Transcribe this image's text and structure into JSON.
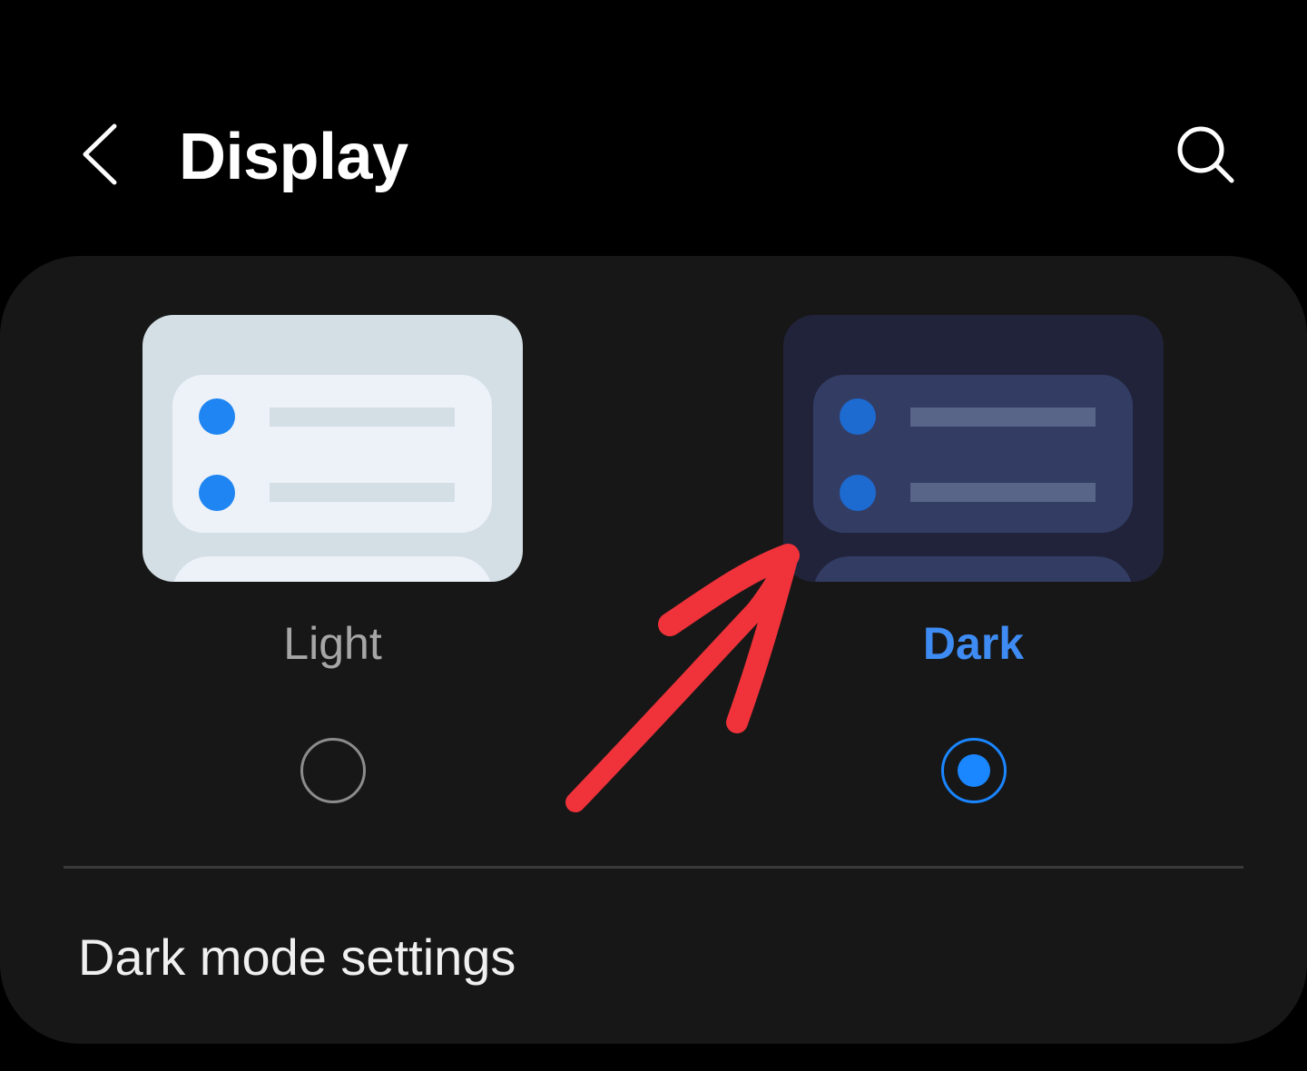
{
  "header": {
    "title": "Display",
    "back_icon": "chevron-left-icon",
    "search_icon": "search-icon"
  },
  "theme_options": [
    {
      "label": "Light",
      "selected": false,
      "label_color": "#a6a6a6"
    },
    {
      "label": "Dark",
      "selected": true,
      "label_color": "#3e8cf3"
    }
  ],
  "settings": {
    "dark_mode_settings_label": "Dark mode settings"
  },
  "annotation": {
    "type": "arrow",
    "color": "#f0323a",
    "points_to": "Dark"
  },
  "colors": {
    "background": "#000000",
    "card": "#171717",
    "accent": "#1a86ff"
  }
}
